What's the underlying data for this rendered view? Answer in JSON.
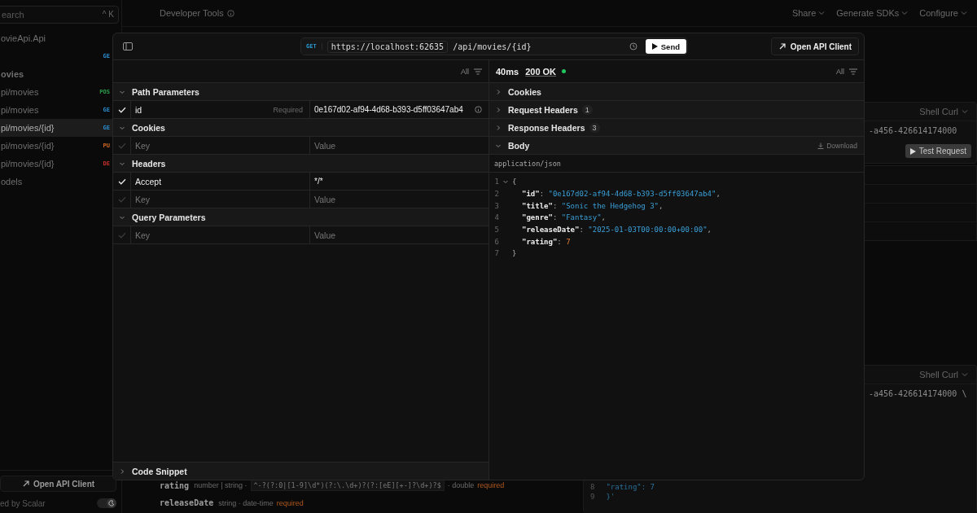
{
  "background": {
    "sidebar": {
      "search": {
        "placeholder": "earch",
        "shortcut": "^ K"
      },
      "items": [
        {
          "kind": "title",
          "label": "ovieApi.Api",
          "selected": false
        },
        {
          "kind": "endpoint",
          "method": "GE",
          "color": "#2b8fd0",
          "selected": false
        },
        {
          "kind": "heading",
          "label": "ovies",
          "selected": false
        },
        {
          "kind": "endpoint",
          "label": "pi/movies",
          "method": "POS",
          "color": "#2e9e4a",
          "selected": false
        },
        {
          "kind": "endpoint",
          "label": "pi/movies",
          "method": "GE",
          "color": "#2b8fd0",
          "selected": false
        },
        {
          "kind": "endpoint",
          "label": "pi/movies/{id}",
          "method": "GE",
          "color": "#2b8fd0",
          "selected": true
        },
        {
          "kind": "endpoint",
          "label": "pi/movies/{id}",
          "method": "PU",
          "color": "#d06a24",
          "selected": false
        },
        {
          "kind": "endpoint",
          "label": "pi/movies/{id}",
          "method": "DE",
          "color": "#c8302b",
          "selected": false
        },
        {
          "kind": "title",
          "label": "odels",
          "selected": false
        }
      ],
      "open_client": "Open API Client",
      "powered_by": "ed by Scalar",
      "dark_mode": true
    },
    "header": {
      "title": "Developer Tools",
      "menus": [
        "Share",
        "Generate SDKs",
        "Configure"
      ]
    },
    "schema": [
      {
        "name": "rating",
        "type": "number | string ·",
        "pattern": "^-?(?:0|[1-9]\\d*)(?:\\.\\d+)?(?:[eE][+-]?\\d+)?$",
        "format": "· double",
        "required": "required"
      },
      {
        "name": "releaseDate",
        "type": "string · date-time",
        "required": "required"
      }
    ],
    "code_cards": [
      {
        "language": "Shell Curl",
        "line": "-a456-426614174000",
        "button": "Test Request"
      },
      {
        "language": "Shell Curl",
        "line": "-a456-426614174000 \\",
        "tail": [
          {
            "number": "8",
            "text": "\"rating\": 7"
          },
          {
            "number": "9",
            "text": "}'"
          }
        ]
      }
    ]
  },
  "modal": {
    "request": {
      "method": "GET",
      "server": "https://localhost:62635",
      "path": "/api/movies/{id}",
      "send": "Send"
    },
    "open_client": "Open API Client",
    "filter": "All",
    "sections": [
      {
        "title": "Path Parameters",
        "expanded": true,
        "rows": [
          {
            "checked": true,
            "key": "id",
            "badge": "Required",
            "value": "0e167d02-af94-4d68-b393-d5ff03647ab4",
            "info": true
          }
        ]
      },
      {
        "title": "Cookies",
        "expanded": true,
        "rows": [
          {
            "checked": false,
            "key_placeholder": "Key",
            "value_placeholder": "Value"
          }
        ]
      },
      {
        "title": "Headers",
        "expanded": true,
        "rows": [
          {
            "checked": true,
            "key": "Accept",
            "value": "*/*"
          },
          {
            "checked": false,
            "key_placeholder": "Key",
            "value_placeholder": "Value"
          }
        ]
      },
      {
        "title": "Query Parameters",
        "expanded": true,
        "rows": [
          {
            "checked": false,
            "key_placeholder": "Key",
            "value_placeholder": "Value"
          }
        ]
      }
    ],
    "code_snippet": {
      "title": "Code Snippet",
      "expanded": false
    },
    "response": {
      "time": "40ms",
      "status": "200 OK",
      "success": true,
      "filter": "All",
      "sections": [
        {
          "title": "Cookies",
          "expanded": false
        },
        {
          "title": "Request Headers",
          "count": "1",
          "expanded": false
        },
        {
          "title": "Response Headers",
          "count": "3",
          "expanded": false
        },
        {
          "title": "Body",
          "expanded": true,
          "action": "Download"
        }
      ],
      "content_type": "application/json",
      "lines": [
        {
          "number": "1",
          "expanded": true,
          "tokens": [
            {
              "kind": "punct",
              "text": "{"
            }
          ],
          "children": [
            {
              "number": "2",
              "tokens": [
                {
                  "kind": "key",
                  "text": "\"id\""
                },
                {
                  "kind": "punct",
                  "text": ": "
                },
                {
                  "kind": "string",
                  "text": "\"0e167d02-af94-4d68-b393-d5ff03647ab4\""
                },
                {
                  "kind": "punct",
                  "text": ","
                }
              ]
            },
            {
              "number": "3",
              "tokens": [
                {
                  "kind": "key",
                  "text": "\"title\""
                },
                {
                  "kind": "punct",
                  "text": ": "
                },
                {
                  "kind": "string",
                  "text": "\"Sonic the Hedgehog 3\""
                },
                {
                  "kind": "punct",
                  "text": ","
                }
              ]
            },
            {
              "number": "4",
              "tokens": [
                {
                  "kind": "key",
                  "text": "\"genre\""
                },
                {
                  "kind": "punct",
                  "text": ": "
                },
                {
                  "kind": "string",
                  "text": "\"Fantasy\""
                },
                {
                  "kind": "punct",
                  "text": ","
                }
              ]
            },
            {
              "number": "5",
              "tokens": [
                {
                  "kind": "key",
                  "text": "\"releaseDate\""
                },
                {
                  "kind": "punct",
                  "text": ": "
                },
                {
                  "kind": "string",
                  "text": "\"2025-01-03T00:00:00+00:00\""
                },
                {
                  "kind": "punct",
                  "text": ","
                }
              ]
            },
            {
              "number": "6",
              "tokens": [
                {
                  "kind": "key",
                  "text": "\"rating\""
                },
                {
                  "kind": "punct",
                  "text": ": "
                },
                {
                  "kind": "number",
                  "text": "7"
                }
              ]
            }
          ]
        },
        {
          "number": "7",
          "tokens": [
            {
              "kind": "punct",
              "text": "}"
            }
          ]
        }
      ]
    }
  }
}
